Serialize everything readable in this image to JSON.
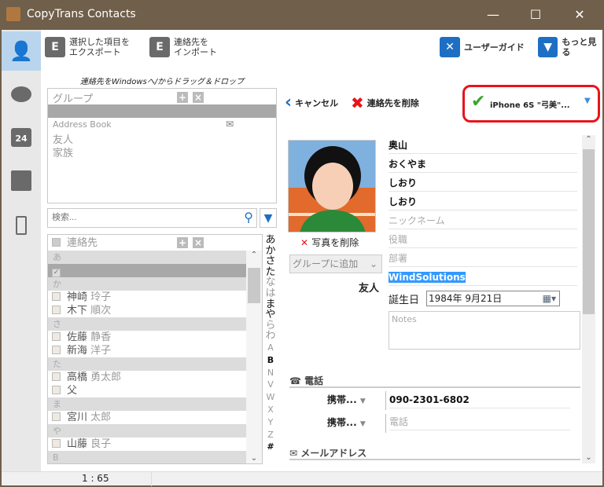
{
  "window": {
    "title": "CopyTrans Contacts",
    "minimize": "—",
    "maximize": "☐",
    "close": "✕"
  },
  "sidebar": {
    "items": [
      {
        "name": "contacts",
        "icon": "person-icon",
        "active": true
      },
      {
        "name": "messages",
        "icon": "speech-bubble-icon"
      },
      {
        "name": "calendar",
        "icon": "calendar-icon",
        "label": "24"
      },
      {
        "name": "notes",
        "icon": "note-icon"
      },
      {
        "name": "device",
        "icon": "phone-icon"
      }
    ]
  },
  "toolbar": {
    "export_label": "選択した項目を\nエクスポート",
    "import_label": "連絡先を\nインポート",
    "guide_label": "ユーザーガイド",
    "more_label": "もっと見る"
  },
  "drag_hint": "連絡先をWindowsへ/からドラッグ＆ドロップ",
  "groups": {
    "header": "グループ",
    "items": [
      "Address Book",
      "友人",
      "家族"
    ]
  },
  "search": {
    "placeholder": "検索..."
  },
  "contacts": {
    "header": "連絡先",
    "rows": [
      {
        "type": "section",
        "label": "あ"
      },
      {
        "type": "contact",
        "last": "",
        "first": "",
        "selected": true,
        "checked": true
      },
      {
        "type": "section",
        "label": "か"
      },
      {
        "type": "contact",
        "last": "神崎",
        "first": "玲子"
      },
      {
        "type": "contact",
        "last": "木下",
        "first": "順次"
      },
      {
        "type": "section",
        "label": "さ"
      },
      {
        "type": "contact",
        "last": "佐藤",
        "first": "静香"
      },
      {
        "type": "contact",
        "last": "新海",
        "first": "洋子"
      },
      {
        "type": "section",
        "label": "た"
      },
      {
        "type": "contact",
        "last": "高橋",
        "first": "勇太郎"
      },
      {
        "type": "contact",
        "last": "父",
        "first": ""
      },
      {
        "type": "section",
        "label": "ま"
      },
      {
        "type": "contact",
        "last": "宮川",
        "first": "太郎"
      },
      {
        "type": "section",
        "label": "や"
      },
      {
        "type": "contact",
        "last": "山藤",
        "first": "良子"
      },
      {
        "type": "section",
        "label": "B"
      }
    ]
  },
  "alpha_index": [
    {
      "c": "あ",
      "on": true
    },
    {
      "c": "か",
      "on": true
    },
    {
      "c": "さ",
      "on": true
    },
    {
      "c": "た",
      "on": true
    },
    {
      "c": "な",
      "on": false
    },
    {
      "c": "は",
      "on": false
    },
    {
      "c": "ま",
      "on": true
    },
    {
      "c": "や",
      "on": true
    },
    {
      "c": "ら",
      "on": false
    },
    {
      "c": "わ",
      "on": false
    },
    {
      "c": "A",
      "on": false
    },
    {
      "c": "B",
      "on": true
    },
    {
      "c": "N",
      "on": false
    },
    {
      "c": "V",
      "on": false
    },
    {
      "c": "W",
      "on": false
    },
    {
      "c": "X",
      "on": false
    },
    {
      "c": "Y",
      "on": false
    },
    {
      "c": "Z",
      "on": false
    },
    {
      "c": "#",
      "on": true
    }
  ],
  "status": {
    "count": "1 : 65"
  },
  "detail": {
    "cancel_label": "キャンセル",
    "delete_label": "連絡先を削除",
    "device": "iPhone 6S \"弓美\"...",
    "remove_photo": "写真を削除",
    "add_group": "グループに追加",
    "group_name": "友人",
    "fields": [
      {
        "value": "奥山",
        "filled": true
      },
      {
        "value": "おくやま",
        "filled": true
      },
      {
        "value": "しおり",
        "filled": true
      },
      {
        "value": "しおり",
        "filled": true
      },
      {
        "value": "ニックネーム",
        "filled": false
      },
      {
        "value": "役職",
        "filled": false
      },
      {
        "value": "部署",
        "filled": false
      },
      {
        "value": "WindSolutions",
        "filled": true,
        "highlighted": true
      }
    ],
    "birthday_label": "誕生日",
    "birthday": "1984年  9月21日",
    "notes_placeholder": "Notes",
    "phone_section": "電話",
    "phones": [
      {
        "type": "携帯...",
        "value": "090-2301-6802",
        "filled": true
      },
      {
        "type": "携帯...",
        "value": "電話",
        "filled": false
      }
    ],
    "email_section": "メールアドレス"
  },
  "colors": {
    "titlebar": "#6f5f4b",
    "accent": "#1e6fc4",
    "highlight": "#3399ff",
    "device_border": "#e8141b",
    "check": "#3aa52f"
  }
}
